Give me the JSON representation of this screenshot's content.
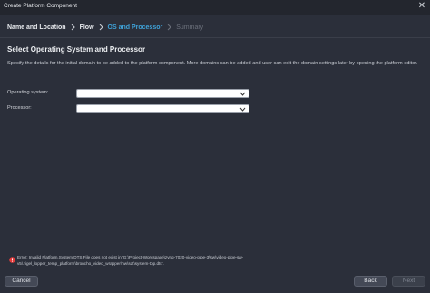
{
  "window": {
    "title": "Create Platform Component",
    "close_glyph": "✕"
  },
  "breadcrumb": {
    "items": [
      {
        "label": "Name and Location",
        "state": "done"
      },
      {
        "label": "Flow",
        "state": "done"
      },
      {
        "label": "OS and Processor",
        "state": "active"
      },
      {
        "label": "Summary",
        "state": "future"
      }
    ]
  },
  "main": {
    "section_title": "Select Operating System and Processor",
    "description": "Specify the details for the initial domain to be added to the platform component. More domains can be added and user can edit the domain settings later by opening the platform editor.",
    "os_label": "Operating system:",
    "os_value": "",
    "processor_label": "Processor:",
    "processor_value": ""
  },
  "error": {
    "icon": "error-icon",
    "message": "Error: Invalid Platform,System DTS File does not exist in 'G:\\Project-Workspace\\zynq-7020-video-pipe-3\\sw\\video-pipe-sw-v5\\.rigel_lopper_temp_platform\\broncho_video_wrapper\\hw\\sdt\\system-top.dts'."
  },
  "footer": {
    "cancel_label": "Cancel",
    "back_label": "Back",
    "next_label": "Next"
  },
  "colors": {
    "background": "#2b2f3a",
    "accent": "#3fa2d8",
    "error": "#e23b3b"
  }
}
